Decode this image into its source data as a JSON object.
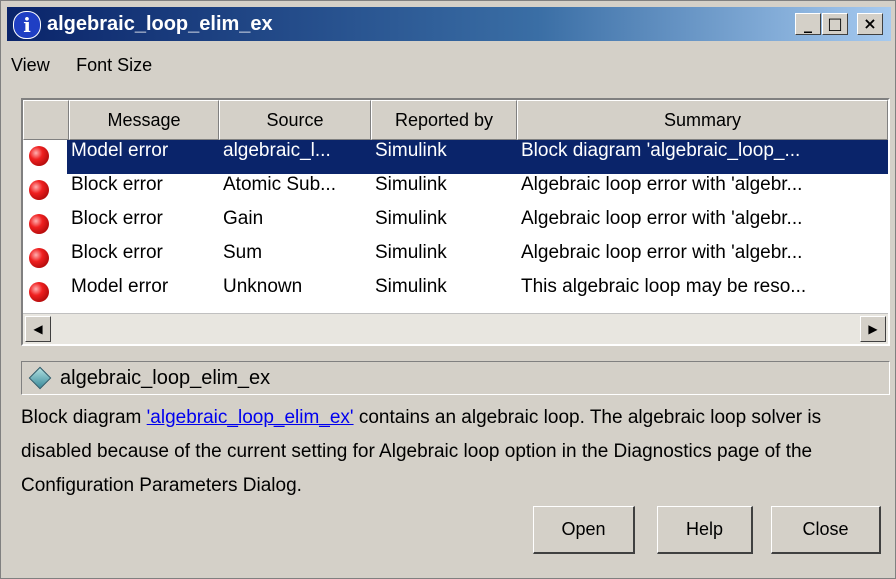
{
  "window": {
    "title": "algebraic_loop_elim_ex",
    "title_icon": "info-icon",
    "title_icon_glyph": "i"
  },
  "title_buttons": {
    "minimize": "_",
    "maximize": "□",
    "close": "×"
  },
  "menu": [
    {
      "label": "View"
    },
    {
      "label": "Font Size"
    }
  ],
  "table": {
    "headers": [
      "Message",
      "Source",
      "Reported by",
      "Summary"
    ],
    "rows": [
      {
        "message": "Model error",
        "source": "algebraic_l...",
        "reported_by": "Simulink",
        "summary": "Block diagram 'algebraic_loop_...",
        "selected": true
      },
      {
        "message": "Block error",
        "source": "Atomic Sub...",
        "reported_by": "Simulink",
        "summary": "Algebraic loop error with 'algebr...",
        "selected": false
      },
      {
        "message": "Block error",
        "source": "Gain",
        "reported_by": "Simulink",
        "summary": "Algebraic loop error with 'algebr...",
        "selected": false
      },
      {
        "message": "Block error",
        "source": "Sum",
        "reported_by": "Simulink",
        "summary": "Algebraic loop error with 'algebr...",
        "selected": false
      },
      {
        "message": "Model error",
        "source": "Unknown",
        "reported_by": "Simulink",
        "summary": "This algebraic loop may be reso...",
        "selected": false
      }
    ],
    "scroll_left": "◀",
    "scroll_right": "▶"
  },
  "path": {
    "text": "algebraic_loop_elim_ex"
  },
  "details": {
    "before": "Block diagram ",
    "link": "'algebraic_loop_elim_ex'",
    "after": " contains an algebraic loop. The algebraic loop solver is disabled because of the current setting for Algebraic loop option in the Diagnostics page of the Configuration Parameters Dialog."
  },
  "buttons": {
    "open": "Open",
    "help": "Help",
    "close": "Close"
  },
  "colors": {
    "selection": "#0a246a",
    "title_start": "#0a246a",
    "title_end": "#a6caf0",
    "error": "#f02020"
  }
}
